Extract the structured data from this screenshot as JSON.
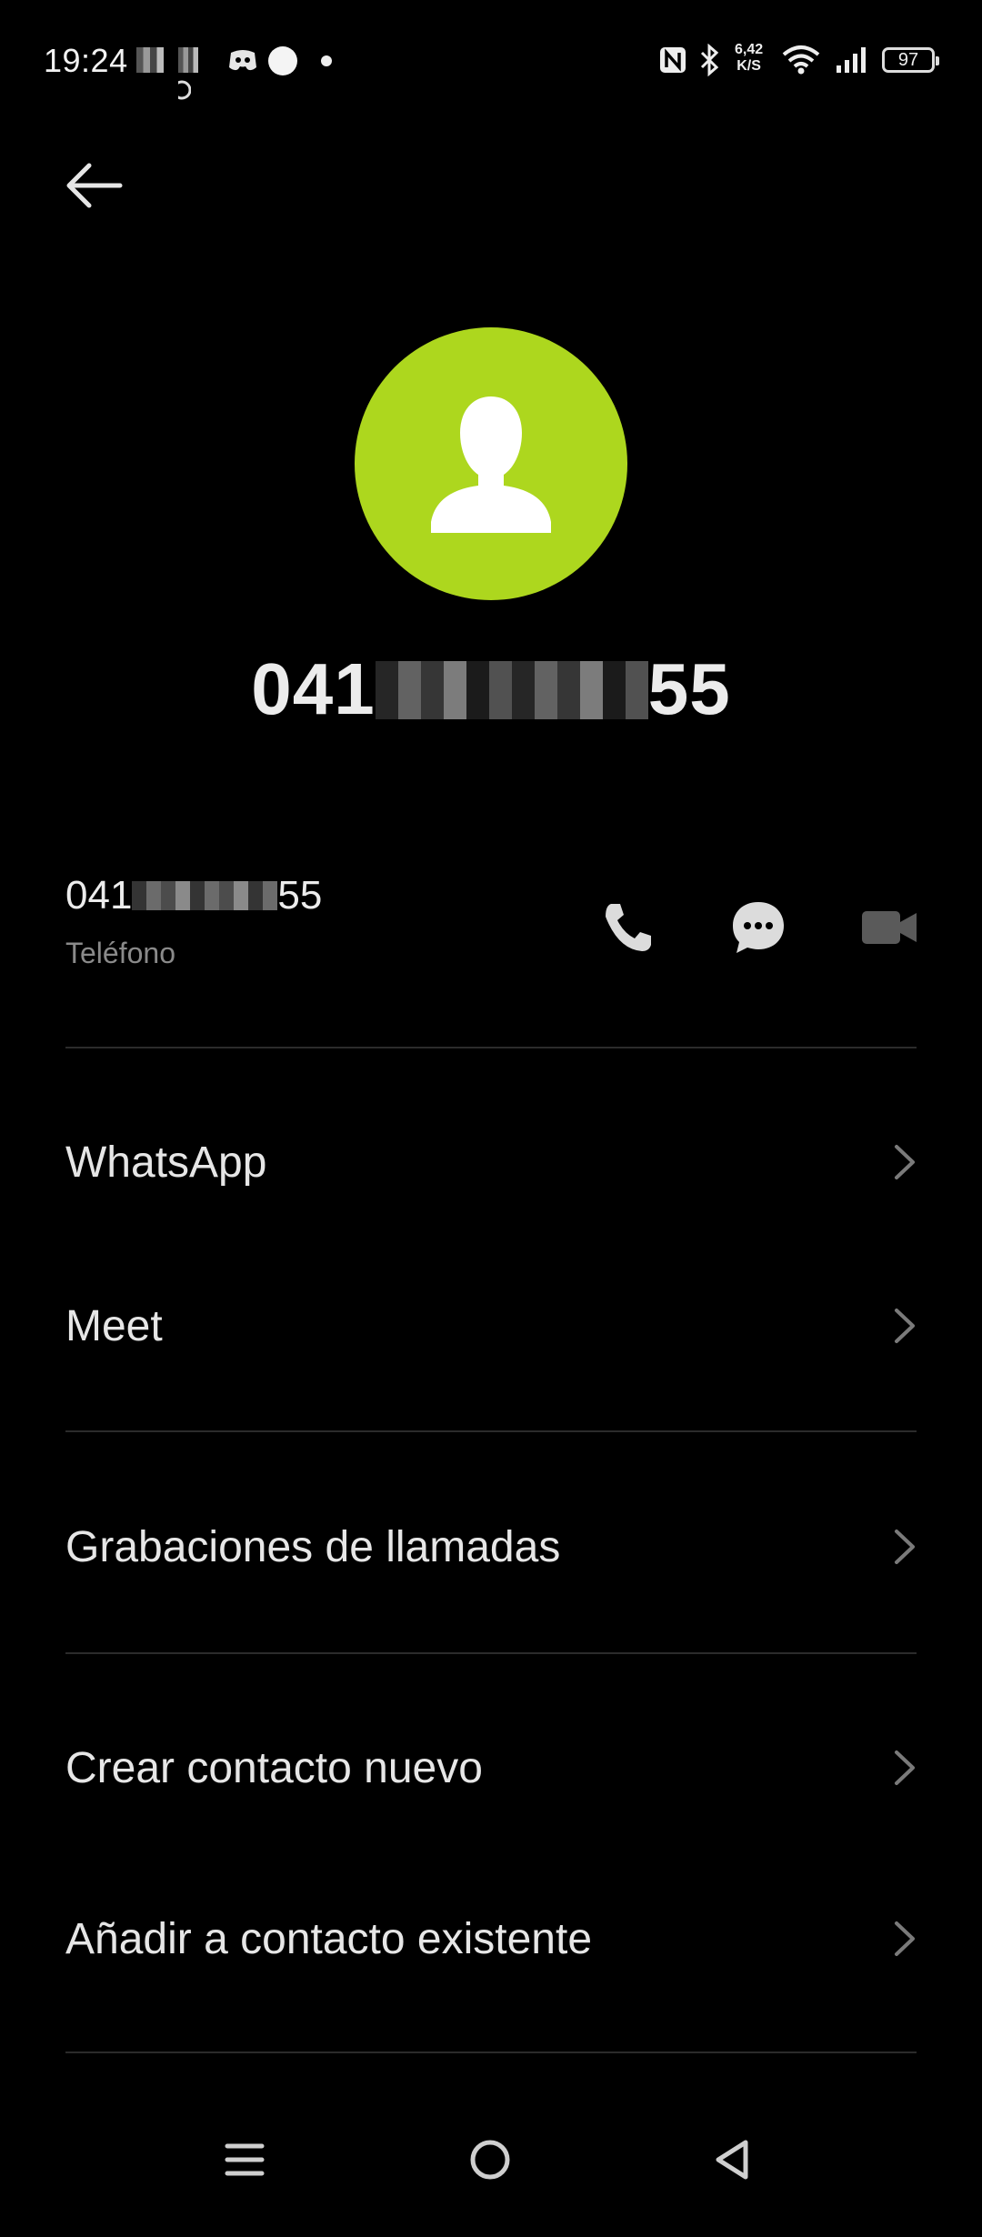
{
  "status_bar": {
    "time": "19:24",
    "speed_value": "6,42",
    "speed_unit": "K/S",
    "battery": "97"
  },
  "contact": {
    "title_start": "041",
    "title_end": "55",
    "phone_start": "041",
    "phone_end": "55",
    "phone_type": "Teléfono"
  },
  "menu": {
    "whatsapp": "WhatsApp",
    "meet": "Meet",
    "recordings": "Grabaciones de llamadas",
    "create_contact": "Crear contacto nuevo",
    "add_existing": "Añadir a contacto existente"
  },
  "colors": {
    "avatar": "#add71e",
    "background": "#000000"
  },
  "icons": [
    "back-arrow-icon",
    "contact-person-icon",
    "phone-icon",
    "message-icon",
    "video-icon",
    "chevron-right-icon",
    "menu-icon",
    "home-icon",
    "back-triangle-icon"
  ]
}
